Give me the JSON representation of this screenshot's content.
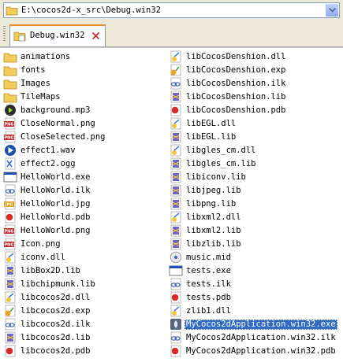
{
  "address": {
    "path": "E:\\cocos2d-x_src\\Debug.win32"
  },
  "tab": {
    "label": "Debug.win32"
  },
  "colors": {
    "selection": "#316ac5",
    "folder": "#f3cd5c",
    "panel_bg": "#ffffff",
    "chrome_bg": "#ece9d8"
  },
  "left_items": [
    {
      "label": "animations",
      "icon": "folder-icon"
    },
    {
      "label": "fonts",
      "icon": "folder-icon"
    },
    {
      "label": "Images",
      "icon": "folder-icon"
    },
    {
      "label": "TileMaps",
      "icon": "folder-icon"
    },
    {
      "label": "background.mp3",
      "icon": "audio-icon"
    },
    {
      "label": "CloseNormal.png",
      "icon": "png-icon"
    },
    {
      "label": "CloseSelected.png",
      "icon": "png-icon"
    },
    {
      "label": "effect1.wav",
      "icon": "media-icon"
    },
    {
      "label": "effect2.ogg",
      "icon": "generic-file-icon"
    },
    {
      "label": "HelloWorld.exe",
      "icon": "exe-icon"
    },
    {
      "label": "HelloWorld.ilk",
      "icon": "ilk-icon"
    },
    {
      "label": "HelloWorld.jpg",
      "icon": "jpg-icon"
    },
    {
      "label": "HelloWorld.pdb",
      "icon": "pdb-icon"
    },
    {
      "label": "HelloWorld.png",
      "icon": "png-icon"
    },
    {
      "label": "Icon.png",
      "icon": "png-icon"
    },
    {
      "label": "iconv.dll",
      "icon": "dll-icon"
    },
    {
      "label": "libBox2D.lib",
      "icon": "lib-icon"
    },
    {
      "label": "libchipmunk.lib",
      "icon": "lib-icon"
    },
    {
      "label": "libcocos2d.dll",
      "icon": "dll-icon"
    },
    {
      "label": "libcocos2d.exp",
      "icon": "exp-icon"
    },
    {
      "label": "libcocos2d.ilk",
      "icon": "ilk-icon"
    },
    {
      "label": "libcocos2d.lib",
      "icon": "lib-icon"
    },
    {
      "label": "libcocos2d.pdb",
      "icon": "pdb-icon"
    }
  ],
  "right_items": [
    {
      "label": "libCocosDenshion.dll",
      "icon": "dll-icon"
    },
    {
      "label": "libCocosDenshion.exp",
      "icon": "exp-icon"
    },
    {
      "label": "libCocosDenshion.ilk",
      "icon": "ilk-icon"
    },
    {
      "label": "libCocosDenshion.lib",
      "icon": "lib-icon"
    },
    {
      "label": "libCocosDenshion.pdb",
      "icon": "pdb-icon"
    },
    {
      "label": "libEGL.dll",
      "icon": "dll-icon"
    },
    {
      "label": "libEGL.lib",
      "icon": "lib-icon"
    },
    {
      "label": "libgles_cm.dll",
      "icon": "dll-icon"
    },
    {
      "label": "libgles_cm.lib",
      "icon": "lib-icon"
    },
    {
      "label": "libiconv.lib",
      "icon": "lib-icon"
    },
    {
      "label": "libjpeg.lib",
      "icon": "lib-icon"
    },
    {
      "label": "libpng.lib",
      "icon": "lib-icon"
    },
    {
      "label": "libxml2.dll",
      "icon": "dll-icon"
    },
    {
      "label": "libxml2.lib",
      "icon": "lib-icon"
    },
    {
      "label": "libzlib.lib",
      "icon": "lib-icon"
    },
    {
      "label": "music.mid",
      "icon": "midi-icon"
    },
    {
      "label": "tests.exe",
      "icon": "exe-icon"
    },
    {
      "label": "tests.ilk",
      "icon": "ilk-icon"
    },
    {
      "label": "tests.pdb",
      "icon": "pdb-icon"
    },
    {
      "label": "zlib1.dll",
      "icon": "dll-icon"
    },
    {
      "label": "MyCocos2dApplication.win32.exe",
      "icon": "app-exe-icon",
      "selected": true
    },
    {
      "label": "MyCocos2dApplication.win32.ilk",
      "icon": "ilk-icon"
    },
    {
      "label": "MyCocos2dApplication.win32.pdb",
      "icon": "pdb-icon"
    }
  ]
}
